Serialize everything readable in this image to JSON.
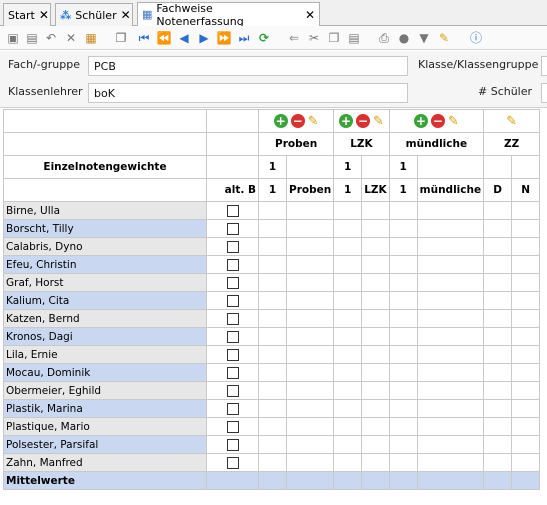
{
  "tabs": [
    {
      "label": "Start",
      "icon": "",
      "active": false
    },
    {
      "label": "Schüler",
      "icon": "people-icon",
      "active": false
    },
    {
      "label": "Fachweise Notenerfassung",
      "icon": "table-icon",
      "active": true
    }
  ],
  "form": {
    "fach_label": "Fach/-gruppe",
    "fach_value": "PCB",
    "klasse_label": "Klasse/Klassengruppe",
    "lehrer_label": "Klassenlehrer",
    "lehrer_value": "boK",
    "schueler_label": "# Schüler"
  },
  "grid": {
    "title": "Einzelnotengewichte",
    "groups": [
      "Proben",
      "LZK",
      "mündliche",
      "ZZ"
    ],
    "weights": [
      "1",
      "1",
      "1"
    ],
    "sub": {
      "altb": "alt. B",
      "proben_n": "1",
      "proben": "Proben",
      "lzk_n": "1",
      "lzk": "LZK",
      "muend_n": "1",
      "muend": "mündliche",
      "zz_d": "D",
      "zz_n": "N"
    },
    "students": [
      "Birne, Ulla",
      "Borscht, Tilly",
      "Calabris, Dyno",
      "Efeu, Christin",
      "Graf, Horst",
      "Kalium, Cita",
      "Katzen, Bernd",
      "Kronos, Dagi",
      "Lila, Ernie",
      "Mocau, Dominik",
      "Obermeier, Eghild",
      "Plastik, Marina",
      "Plastique, Mario",
      "Polsester, Parsifal",
      "Zahn, Manfred"
    ],
    "footer": "Mittelwerte"
  }
}
